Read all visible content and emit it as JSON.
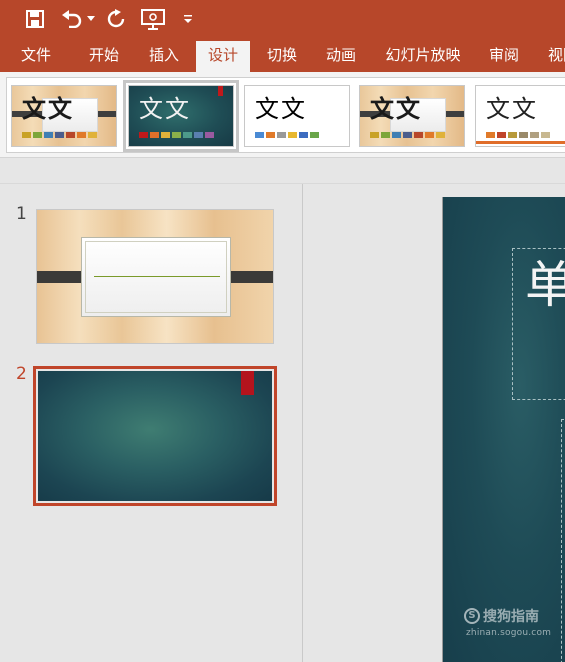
{
  "colors": {
    "accent": "#b7472a",
    "ribbon_bg": "#f3f3f3",
    "selected_slide_border": "#c0452a",
    "slide_teal": "#1e4b56"
  },
  "quick_access": {
    "icons": [
      "save-icon",
      "undo-icon",
      "undo-dropdown-icon",
      "redo-icon",
      "present-from-start-icon",
      "customize-qat-icon"
    ]
  },
  "ribbon_tabs": [
    {
      "label": "文件",
      "active": false
    },
    {
      "label": "开始",
      "active": false
    },
    {
      "label": "插入",
      "active": false
    },
    {
      "label": "设计",
      "active": true
    },
    {
      "label": "切换",
      "active": false
    },
    {
      "label": "动画",
      "active": false
    },
    {
      "label": "幻灯片放映",
      "active": false
    },
    {
      "label": "审阅",
      "active": false
    },
    {
      "label": "视图",
      "active": false
    }
  ],
  "themes": [
    {
      "title": "文文",
      "style": "wood",
      "bars": [
        "#c9a227",
        "#7ea63a",
        "#3f7fb4",
        "#4b5d8c",
        "#b7472a",
        "#e07a2a",
        "#e0b23a"
      ]
    },
    {
      "title": "文文",
      "style": "teal",
      "selected": true,
      "bars": [
        "#c0191b",
        "#e0702a",
        "#e0b23a",
        "#8bb04a",
        "#4d9a8a",
        "#5a7fb0",
        "#9a5aa0"
      ]
    },
    {
      "title": "文文",
      "style": "plain",
      "bars": [
        "#4a8ad4",
        "#e07a2a",
        "#9a9a9a",
        "#e8b830",
        "#3d6cc0",
        "#6aa64a"
      ]
    },
    {
      "title": "文文",
      "style": "wood",
      "bars": [
        "#c9a227",
        "#7ea63a",
        "#3f7fb4",
        "#4b5d8c",
        "#b7472a",
        "#e07a2a",
        "#e0b23a"
      ]
    },
    {
      "title": "文文",
      "style": "plain4",
      "bars": [
        "#e07a2a",
        "#c0452a",
        "#b89a3a",
        "#9a8a6a",
        "#b0a080",
        "#c8b890"
      ]
    }
  ],
  "slides": [
    {
      "number": "1",
      "selected": false
    },
    {
      "number": "2",
      "selected": true
    }
  ],
  "main_slide": {
    "title_text": "单"
  },
  "watermark": {
    "brand": "搜狗指南",
    "url": "zhinan.sogou.com",
    "logo_letter": "S"
  }
}
